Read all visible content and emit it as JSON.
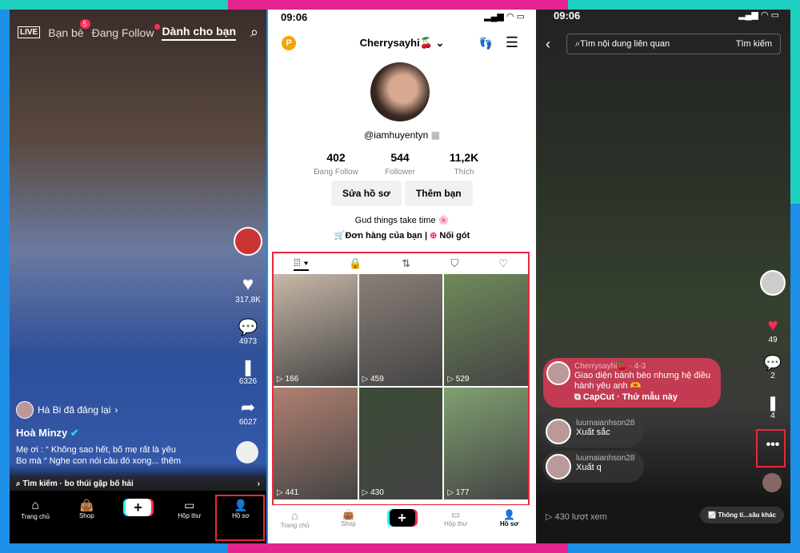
{
  "feed": {
    "live": "LIVE",
    "tabs": [
      "Bạn bè",
      "Đang Follow",
      "Dành cho bạn"
    ],
    "friends_badge": "5",
    "likes": "317,8K",
    "comments": "4973",
    "saves": "6326",
    "shares": "6027",
    "repost": "Hà Bi đã đăng lại",
    "author": "Hoà Minzy",
    "caption_1": "Mẹ ơi : “ Không sao hết, bố mẹ rất là yêu",
    "caption_2": "Bo mà “ Nghe con nói câu đó xong... thêm",
    "search_hint": "Tìm kiếm · bo thúi gặp bố hải",
    "nav": [
      "Trang chủ",
      "Shop",
      "Hộp thư",
      "Hồ sơ"
    ]
  },
  "profile": {
    "time": "09:06",
    "username": "Cherrysayhi🍒",
    "handle": "@iamhuyentyn",
    "stats": [
      {
        "value": "402",
        "label": "Đang Follow"
      },
      {
        "value": "544",
        "label": "Follower"
      },
      {
        "value": "11,2K",
        "label": "Thích"
      }
    ],
    "edit": "Sửa hồ sơ",
    "add_friend": "Thêm bạn",
    "bio": "Gud things take time 🌸",
    "orders": "Đơn hàng của bạn",
    "noi_got": "Nối gót",
    "videos": [
      {
        "views": "166",
        "color": "#c9b8a8"
      },
      {
        "views": "459",
        "color": "#8a7f78"
      },
      {
        "views": "529",
        "color": "#6f8a5a"
      },
      {
        "views": "441",
        "color": "#b08070"
      },
      {
        "views": "430",
        "color": "#3b4a36"
      },
      {
        "views": "177",
        "color": "#7fa070"
      }
    ],
    "nav": [
      "Trang chủ",
      "Shop",
      "Hộp thư",
      "Hồ sơ"
    ]
  },
  "video": {
    "time": "09:06",
    "search_placeholder": "Tìm nội dung liên quan",
    "search_btn": "Tìm kiếm",
    "likes": "49",
    "comments": "2",
    "saves": "4",
    "pinned": {
      "user": "Cherrysayhi🍒 · 4-3",
      "text": "Giao diện bánh bèo nhưng hệ điều hành yêu anh 🫶",
      "capcut": "CapCut · Thử mẫu này"
    },
    "comments_list": [
      {
        "user": "luumaianhson28",
        "text": "Xuất sắc"
      },
      {
        "user": "luumaianhson28",
        "text": "Xuất q"
      }
    ],
    "views": "430 lượt xem",
    "insights": "Thông ti...sâu khác"
  },
  "colors": {
    "accent": "#fe2c55",
    "highlight": "#e8283c"
  }
}
